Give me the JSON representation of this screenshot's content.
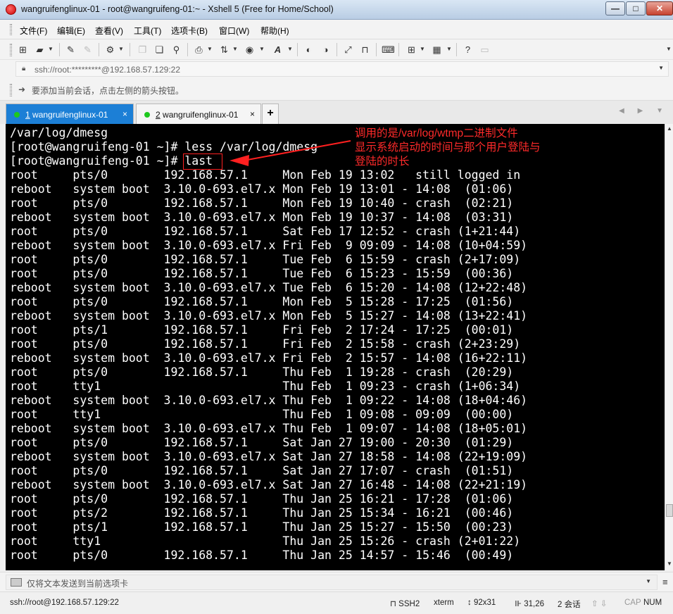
{
  "window": {
    "title": "wangruifenglinux-01 - root@wangruifeng-01:~ - Xshell 5 (Free for Home/School)",
    "controls": {
      "minimize": "—",
      "maximize": "□",
      "close": "✕"
    }
  },
  "menu": {
    "items": [
      "文件(F)",
      "编辑(E)",
      "查看(V)",
      "工具(T)",
      "选项卡(B)",
      "窗口(W)",
      "帮助(H)"
    ]
  },
  "address": {
    "text": "ssh://root:*********@192.168.57.129:22",
    "dropdown": "▼"
  },
  "hint": {
    "text": "要添加当前会话，点击左侧的箭头按钮。"
  },
  "tabs": [
    {
      "num": "1",
      "label": " wangruifenglinux-01",
      "close": "×",
      "active": true
    },
    {
      "num": "2",
      "label": " wangruifenglinux-01",
      "close": "×",
      "active": false
    }
  ],
  "tab_add": "+",
  "tab_nav": "◀ ▶ ▼",
  "terminal": {
    "lines": [
      "/var/log/dmesg",
      "[root@wangruifeng-01 ~]# less /var/log/dmesg",
      "[root@wangruifeng-01 ~]# last",
      "root     pts/0        192.168.57.1     Mon Feb 19 13:02   still logged in",
      "reboot   system boot  3.10.0-693.el7.x Mon Feb 19 13:01 - 14:08  (01:06)",
      "root     pts/0        192.168.57.1     Mon Feb 19 10:40 - crash  (02:21)",
      "reboot   system boot  3.10.0-693.el7.x Mon Feb 19 10:37 - 14:08  (03:31)",
      "root     pts/0        192.168.57.1     Sat Feb 17 12:52 - crash (1+21:44)",
      "reboot   system boot  3.10.0-693.el7.x Fri Feb  9 09:09 - 14:08 (10+04:59)",
      "root     pts/0        192.168.57.1     Tue Feb  6 15:59 - crash (2+17:09)",
      "root     pts/0        192.168.57.1     Tue Feb  6 15:23 - 15:59  (00:36)",
      "reboot   system boot  3.10.0-693.el7.x Tue Feb  6 15:20 - 14:08 (12+22:48)",
      "root     pts/0        192.168.57.1     Mon Feb  5 15:28 - 17:25  (01:56)",
      "reboot   system boot  3.10.0-693.el7.x Mon Feb  5 15:27 - 14:08 (13+22:41)",
      "root     pts/1        192.168.57.1     Fri Feb  2 17:24 - 17:25  (00:01)",
      "root     pts/0        192.168.57.1     Fri Feb  2 15:58 - crash (2+23:29)",
      "reboot   system boot  3.10.0-693.el7.x Fri Feb  2 15:57 - 14:08 (16+22:11)",
      "root     pts/0        192.168.57.1     Thu Feb  1 19:28 - crash  (20:29)",
      "root     tty1                          Thu Feb  1 09:23 - crash (1+06:34)",
      "reboot   system boot  3.10.0-693.el7.x Thu Feb  1 09:22 - 14:08 (18+04:46)",
      "root     tty1                          Thu Feb  1 09:08 - 09:09  (00:00)",
      "reboot   system boot  3.10.0-693.el7.x Thu Feb  1 09:07 - 14:08 (18+05:01)",
      "root     pts/0        192.168.57.1     Sat Jan 27 19:00 - 20:30  (01:29)",
      "reboot   system boot  3.10.0-693.el7.x Sat Jan 27 18:58 - 14:08 (22+19:09)",
      "root     pts/0        192.168.57.1     Sat Jan 27 17:07 - crash  (01:51)",
      "reboot   system boot  3.10.0-693.el7.x Sat Jan 27 16:48 - 14:08 (22+21:19)",
      "root     pts/0        192.168.57.1     Thu Jan 25 16:21 - 17:28  (01:06)",
      "root     pts/2        192.168.57.1     Thu Jan 25 15:34 - 16:21  (00:46)",
      "root     pts/1        192.168.57.1     Thu Jan 25 15:27 - 15:50  (00:23)",
      "root     tty1                          Thu Jan 25 15:26 - crash (2+01:22)",
      "root     pts/0        192.168.57.1     Thu Jan 25 14:57 - 15:46  (00:49)"
    ],
    "annotation": [
      "调用的是/var/log/wtmp二进制文件",
      "显示系统启动的时间与那个用户登陆与",
      "登陆的时长"
    ],
    "annotation_color": "#ff2a2a"
  },
  "send": {
    "text": "仅将文本发送到当前选项卡",
    "dropdown": "▼",
    "menu": "≡"
  },
  "status": {
    "connection": "ssh://root@192.168.57.129:22",
    "protocol": "SSH2",
    "term": "xterm",
    "size": "92x31",
    "cursor": "31,26",
    "sessions": "2 会话",
    "caps": "CAP",
    "num": "NUM"
  },
  "colors": {
    "terminal_bg": "#000000",
    "terminal_fg": "#ffffff",
    "tab_active": "#1c7fd6",
    "tab_dot": "#1ec81e"
  }
}
